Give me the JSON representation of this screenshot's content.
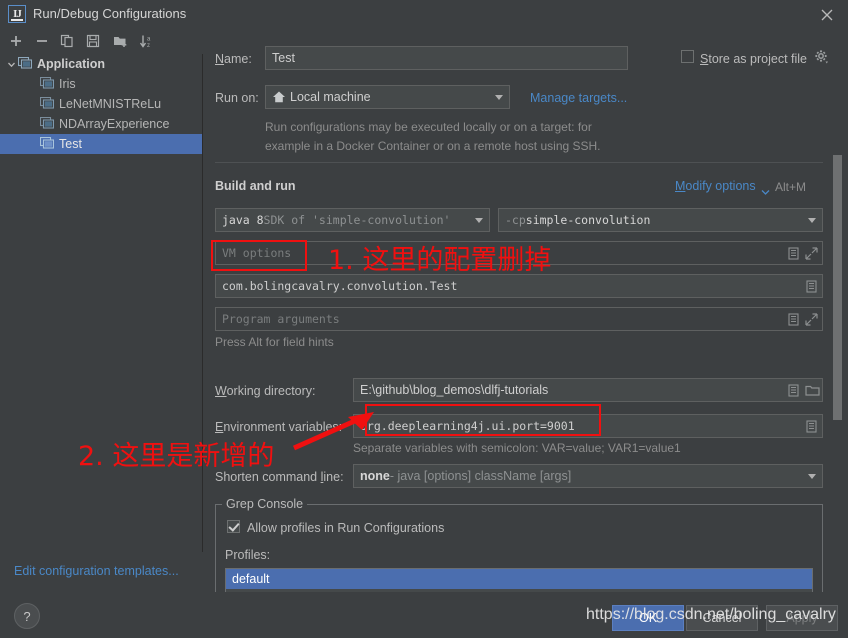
{
  "window": {
    "title": "Run/Debug Configurations",
    "logo_text": "IJ",
    "close_icon": "close-icon"
  },
  "toolbar": {
    "items": [
      {
        "name": "add-configuration-button",
        "icon": "plus-icon",
        "label": "+"
      },
      {
        "name": "remove-configuration-button",
        "icon": "minus-icon",
        "label": "−"
      },
      {
        "name": "copy-configuration-button",
        "icon": "copy-icon",
        "label": "copy"
      },
      {
        "name": "save-configuration-button",
        "icon": "save-icon",
        "label": "save"
      },
      {
        "name": "new-folder-button",
        "icon": "new-folder-icon",
        "label": "new folder"
      },
      {
        "name": "sort-configurations-button",
        "icon": "sort-az-icon",
        "label": "sort a-z"
      }
    ]
  },
  "sidebar": {
    "root": {
      "label": "Application",
      "icon": "application-icon",
      "expanded": true,
      "chevron": "chevron-down-icon"
    },
    "items": [
      {
        "label": "Iris",
        "icon": "configuration-icon",
        "selected": false
      },
      {
        "label": "LeNetMNISTReLu",
        "icon": "configuration-icon",
        "selected": false
      },
      {
        "label": "NDArrayExperience",
        "icon": "configuration-icon",
        "selected": false
      },
      {
        "label": "Test",
        "icon": "configuration-icon",
        "selected": true
      }
    ],
    "edit_templates_link": "Edit configuration templates..."
  },
  "form": {
    "name_label": "Name:",
    "name_label_mnemonic": "N",
    "name_value": "Test",
    "store_as_project_file_label": "Store as project file",
    "store_as_project_file_mnemonic": "S",
    "store_as_project_file_checked": false,
    "store_gear_icon": "gear-icon",
    "run_on_label": "Run on:",
    "run_on_value": "Local machine",
    "run_on_icon": "home-icon",
    "manage_targets_link": "Manage targets...",
    "run_on_description_line1": "Run configurations may be executed locally or on a target: for",
    "run_on_description_line2": "example in a Docker Container or on a remote host using SSH.",
    "build_and_run_title": "Build and run",
    "modify_options_link": "Modify options",
    "modify_options_mnemonic": "M",
    "modify_options_shortcut": "Alt+M",
    "modify_options_chevron": "chevron-down-icon",
    "jre_value_bold": "java 8",
    "jre_value_rest": " SDK of 'simple-convolution'",
    "classpath_value_dim": "-cp ",
    "classpath_value": "simple-convolution",
    "vm_options_placeholder": "VM options",
    "main_class_value": "com.bolingcavalry.convolution.Test",
    "program_arguments_placeholder": "Program arguments",
    "field_hint": "Press Alt for field hints",
    "working_directory_label": "Working directory:",
    "working_directory_mnemonic": "W",
    "working_directory_value": "E:\\github\\blog_demos\\dlfj-tutorials",
    "environment_variables_label": "Environment variables:",
    "environment_variables_mnemonic": "E",
    "environment_variables_value": "org.deeplearning4j.ui.port=9001",
    "environment_variables_hint": "Separate variables with semicolon: VAR=value; VAR1=value1",
    "shorten_command_line_label": "Shorten command line:",
    "shorten_command_line_mnemonic": "l",
    "shorten_command_line_value_bold": "none",
    "shorten_command_line_value_rest": " - java [options] className [args]",
    "grep_console_legend": "Grep Console",
    "allow_profiles_label": "Allow profiles in Run Configurations",
    "allow_profiles_checked": true,
    "profiles_label": "Profiles:",
    "profiles_items": [
      {
        "label": "default",
        "selected": true
      }
    ],
    "expand_icon": "expand-icon",
    "editor_icon": "open-editor-icon",
    "browse_icon": "folder-browse-icon"
  },
  "footer": {
    "help_label": "?",
    "ok_label": "OK",
    "cancel_label": "Cancel",
    "apply_label": "Apply"
  },
  "watermark": {
    "text": "https://blog.csdn.net/boling_cavalry"
  },
  "annotations": [
    {
      "name": "annotation-1-text",
      "text": "1. 这里的配置删掉",
      "color": "#f01010"
    },
    {
      "name": "annotation-2-text",
      "text": "2. 这里是新增的",
      "color": "#f01010"
    }
  ],
  "colors": {
    "background": "#3c3f41",
    "selection": "#4b6eaf",
    "link": "#4a88c7",
    "annotation": "#f01010",
    "field_background": "#45494a"
  }
}
